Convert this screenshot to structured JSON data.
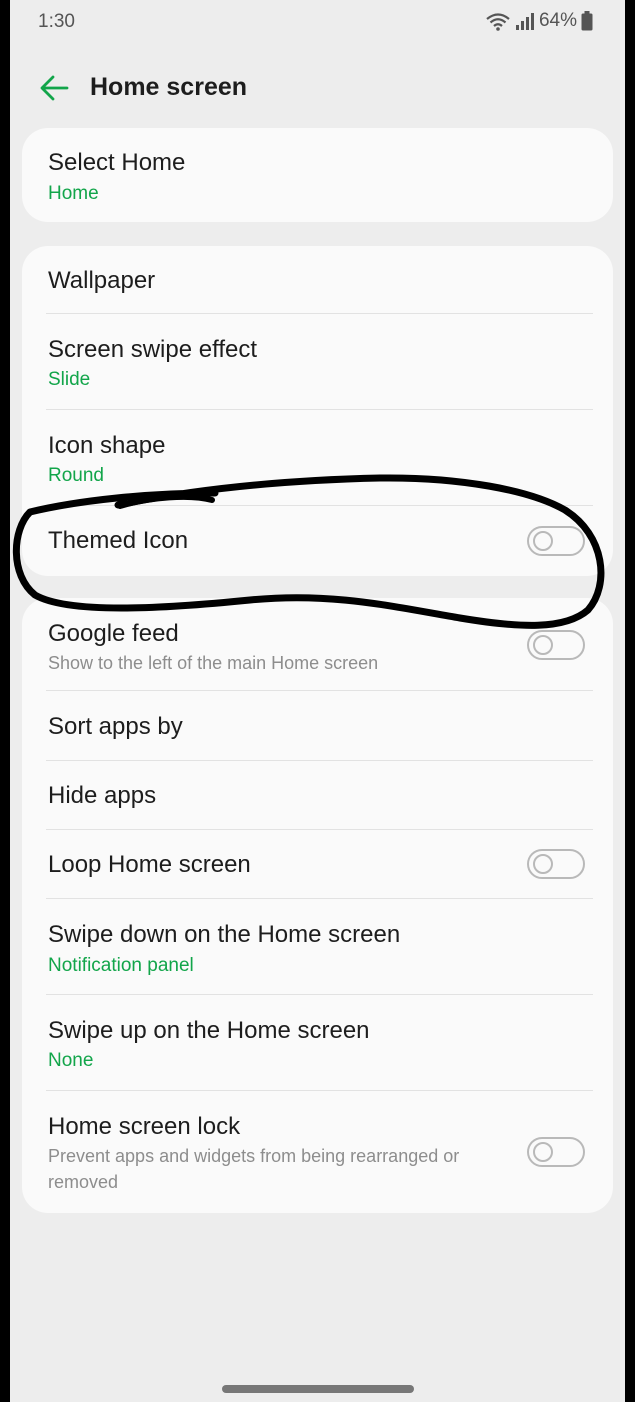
{
  "status_bar": {
    "time": "1:30",
    "battery": "64%"
  },
  "header": {
    "title": "Home screen",
    "back_icon": "arrow-left-icon"
  },
  "colors": {
    "accent": "#12a54a",
    "background": "#ededed",
    "card": "#fafafa",
    "annotation": "#000000"
  },
  "card1": {
    "select_home": {
      "title": "Select Home",
      "value": "Home"
    }
  },
  "card2": {
    "wallpaper": {
      "title": "Wallpaper"
    },
    "swipe_effect": {
      "title": "Screen swipe effect",
      "value": "Slide"
    },
    "icon_shape": {
      "title": "Icon shape",
      "value": "Round"
    },
    "themed_icon": {
      "title": "Themed Icon",
      "enabled": false
    }
  },
  "card3": {
    "google_feed": {
      "title": "Google feed",
      "description": "Show to the left of the main Home screen",
      "enabled": false
    },
    "sort_apps": {
      "title": "Sort apps by"
    },
    "hide_apps": {
      "title": "Hide apps"
    },
    "loop_home": {
      "title": "Loop Home screen",
      "enabled": false
    },
    "swipe_down": {
      "title": "Swipe down on the Home screen",
      "value": "Notification panel"
    },
    "swipe_up": {
      "title": "Swipe up on the Home screen",
      "value": "None"
    },
    "home_lock": {
      "title": "Home screen lock",
      "description": "Prevent apps and widgets from being rearranged or removed",
      "enabled": false
    }
  }
}
